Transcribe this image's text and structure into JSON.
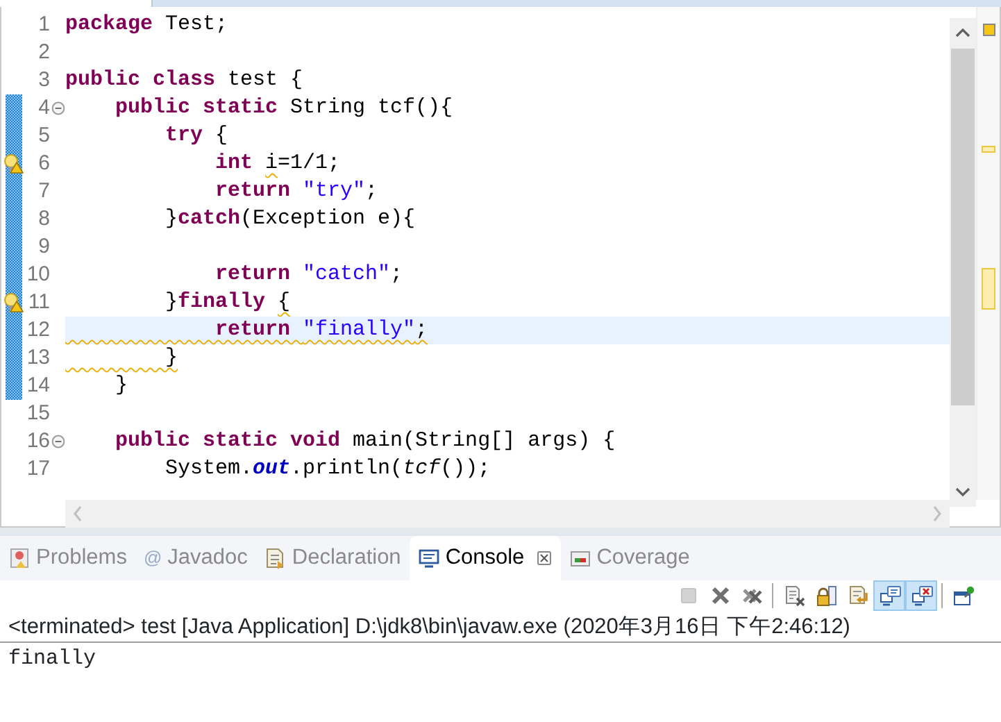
{
  "editor": {
    "lines": [
      {
        "n": "1",
        "changed": false,
        "folding": false,
        "warning": false,
        "current": false,
        "squiggle": false,
        "tokens": [
          {
            "t": "package",
            "kind": "kw"
          },
          {
            "t": " Test;",
            "kind": "plain"
          }
        ]
      },
      {
        "n": "2",
        "changed": false,
        "folding": false,
        "warning": false,
        "current": false,
        "squiggle": false
      },
      {
        "n": "3",
        "changed": false,
        "folding": false,
        "warning": false,
        "current": false,
        "squiggle": false,
        "tokens": [
          {
            "t": "public class",
            "kind": "kw"
          },
          {
            "t": " test {",
            "kind": "plain"
          }
        ]
      },
      {
        "n": "4",
        "changed": true,
        "folding": true,
        "warning": false,
        "current": false,
        "squiggle": false,
        "tokens": [
          {
            "t": "    public static",
            "kind": "kw"
          },
          {
            "t": " String tcf(){",
            "kind": "plain"
          }
        ]
      },
      {
        "n": "5",
        "changed": true,
        "folding": false,
        "warning": false,
        "current": false,
        "squiggle": false,
        "tokens": [
          {
            "t": "        try",
            "kind": "kw"
          },
          {
            "t": " {",
            "kind": "plain"
          }
        ]
      },
      {
        "n": "6",
        "changed": true,
        "folding": false,
        "warning": true,
        "current": false,
        "squiggle": false,
        "tokens": [
          {
            "t": "            int ",
            "kind": "kw"
          },
          {
            "t": "i",
            "kind": "plain",
            "squiggle": true
          },
          {
            "t": "=1/1;",
            "kind": "plain"
          }
        ]
      },
      {
        "n": "7",
        "changed": true,
        "folding": false,
        "warning": false,
        "current": false,
        "squiggle": false,
        "tokens": [
          {
            "t": "            return ",
            "kind": "kw"
          },
          {
            "t": "\"try\"",
            "kind": "str"
          },
          {
            "t": ";",
            "kind": "plain"
          }
        ]
      },
      {
        "n": "8",
        "changed": true,
        "folding": false,
        "warning": false,
        "current": false,
        "squiggle": false,
        "tokens": [
          {
            "t": "        }",
            "kind": "plain"
          },
          {
            "t": "catch",
            "kind": "kw"
          },
          {
            "t": "(Exception e){",
            "kind": "plain"
          }
        ]
      },
      {
        "n": "9",
        "changed": true,
        "folding": false,
        "warning": false,
        "current": false,
        "squiggle": false
      },
      {
        "n": "10",
        "changed": true,
        "folding": false,
        "warning": false,
        "current": false,
        "squiggle": false,
        "tokens": [
          {
            "t": "            return ",
            "kind": "kw"
          },
          {
            "t": "\"catch\"",
            "kind": "str"
          },
          {
            "t": ";",
            "kind": "plain"
          }
        ]
      },
      {
        "n": "11",
        "changed": true,
        "folding": false,
        "warning": true,
        "current": false,
        "squiggle": false,
        "tokens": [
          {
            "t": "        }",
            "kind": "plain"
          },
          {
            "t": "finally ",
            "kind": "kw"
          },
          {
            "t": "{",
            "kind": "plain",
            "squiggle": true
          }
        ]
      },
      {
        "n": "12",
        "changed": true,
        "folding": false,
        "warning": false,
        "current": true,
        "squiggle": true,
        "tokens": [
          {
            "t": "            return ",
            "kind": "kw"
          },
          {
            "t": "\"finally\"",
            "kind": "str"
          },
          {
            "t": ";",
            "kind": "plain"
          }
        ]
      },
      {
        "n": "13",
        "changed": true,
        "folding": false,
        "warning": false,
        "current": false,
        "squiggle": true,
        "tokens": [
          {
            "t": "        }",
            "kind": "plain"
          }
        ]
      },
      {
        "n": "14",
        "changed": true,
        "folding": false,
        "warning": false,
        "current": false,
        "squiggle": false,
        "tokens": [
          {
            "t": "    }",
            "kind": "plain"
          }
        ]
      },
      {
        "n": "15",
        "changed": false,
        "folding": false,
        "warning": false,
        "current": false,
        "squiggle": false
      },
      {
        "n": "16",
        "changed": false,
        "folding": true,
        "warning": false,
        "current": false,
        "squiggle": false,
        "tokens": [
          {
            "t": "    public static void",
            "kind": "kw"
          },
          {
            "t": " main(String[] args) {",
            "kind": "plain"
          }
        ]
      },
      {
        "n": "17",
        "changed": false,
        "folding": false,
        "warning": false,
        "current": false,
        "squiggle": false,
        "tokens": [
          {
            "t": "        System.",
            "kind": "plain"
          },
          {
            "t": "out",
            "kind": "field"
          },
          {
            "t": ".println(",
            "kind": "plain"
          },
          {
            "t": "tcf",
            "kind": "static"
          },
          {
            "t": "());",
            "kind": "plain"
          }
        ]
      }
    ]
  },
  "panel": {
    "tabs": [
      {
        "label": "Problems",
        "kind": "problems",
        "selected": false
      },
      {
        "label": "Javadoc",
        "kind": "javadoc",
        "glyph": "@",
        "selected": false
      },
      {
        "label": "Declaration",
        "kind": "declaration",
        "selected": false
      },
      {
        "label": "Console",
        "kind": "console",
        "selected": true
      },
      {
        "label": "Coverage",
        "kind": "coverage",
        "selected": false
      }
    ],
    "toolbar": [
      {
        "kind": "stop",
        "disabled": true,
        "selected": false
      },
      {
        "kind": "remove",
        "disabled": false,
        "selected": false
      },
      {
        "kind": "remove-all",
        "disabled": false,
        "selected": false
      },
      {
        "kind": "sep"
      },
      {
        "kind": "clear",
        "disabled": false,
        "selected": false
      },
      {
        "kind": "scroll-lock",
        "disabled": false,
        "selected": false
      },
      {
        "kind": "word-wrap",
        "disabled": false,
        "selected": false
      },
      {
        "kind": "stdout",
        "disabled": false,
        "selected": true
      },
      {
        "kind": "stderr",
        "disabled": false,
        "selected": true
      },
      {
        "kind": "sep"
      },
      {
        "kind": "pin",
        "disabled": false,
        "selected": false
      }
    ],
    "header": "<terminated> test [Java Application] D:\\jdk8\\bin\\javaw.exe (2020年3月16日 下午2:46:12)",
    "output": "finally"
  }
}
